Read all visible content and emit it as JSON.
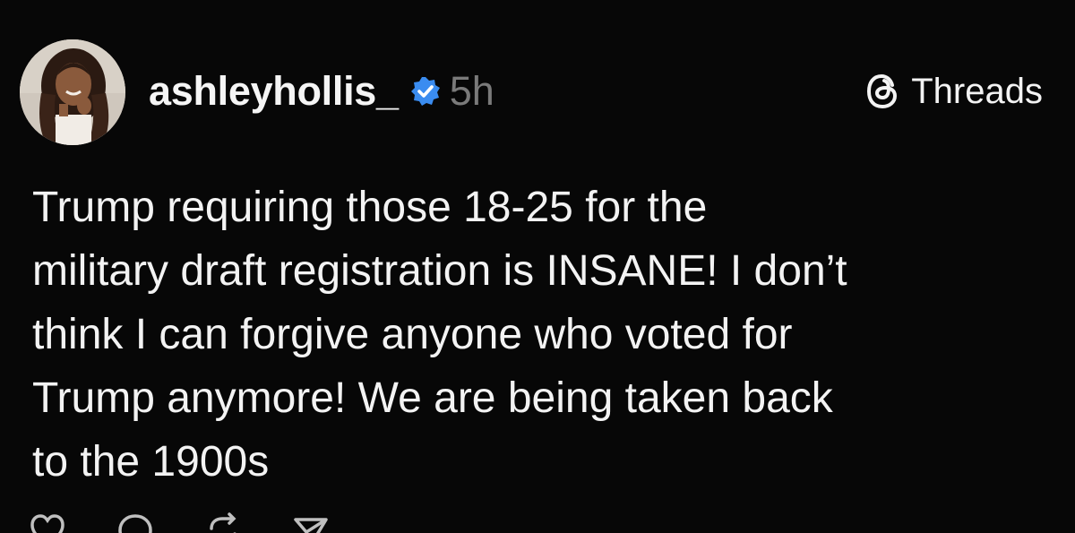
{
  "post": {
    "username": "ashleyhollis_",
    "timestamp": "5h",
    "verified": true,
    "platform_label": "Threads",
    "text_lines": [
      "Trump requiring those 18-25 for the",
      "military draft registration is INSANE! I don’t",
      "think I can forgive anyone who voted for",
      "Trump anymore! We are being taken back",
      "to the 1900s"
    ]
  },
  "actions": [
    {
      "name": "like",
      "icon": "heart-icon"
    },
    {
      "name": "reply",
      "icon": "comment-icon"
    },
    {
      "name": "repost",
      "icon": "repost-icon"
    },
    {
      "name": "share",
      "icon": "send-icon"
    }
  ],
  "colors": {
    "background": "#070707",
    "text": "#f3f3f3",
    "timestamp": "#7a7a7a",
    "verified_badge": "#3a8cf0"
  }
}
